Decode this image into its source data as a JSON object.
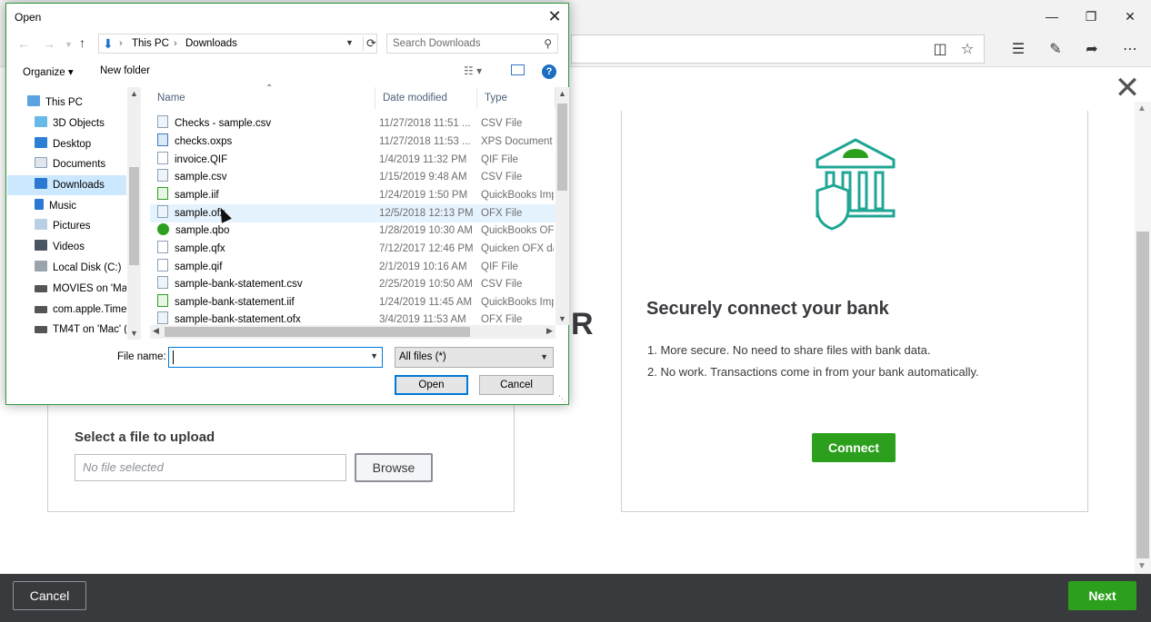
{
  "page": {
    "upload_title": "Select a file to upload",
    "file_field_placeholder": "No file selected",
    "browse_label": "Browse",
    "partial_heading_letter": "R",
    "right_heading": "Securely connect your bank",
    "benefits": [
      "1.  More secure. No need to share files with bank data.",
      "2.  No work. Transactions come in from your bank automatically."
    ],
    "connect_label": "Connect",
    "footer_cancel": "Cancel",
    "footer_next": "Next",
    "close_glyph": "✕"
  },
  "dialog": {
    "title": "Open",
    "breadcrumb": [
      "This PC",
      "Downloads"
    ],
    "search_placeholder": "Search Downloads",
    "organize_label": "Organize ▾",
    "new_folder_label": "New folder",
    "help_label": "?",
    "nav_items": [
      {
        "label": "This PC",
        "icon": "computer-icon"
      },
      {
        "label": "3D Objects",
        "icon": "cube-icon"
      },
      {
        "label": "Desktop",
        "icon": "desktop-icon"
      },
      {
        "label": "Documents",
        "icon": "document-icon"
      },
      {
        "label": "Downloads",
        "icon": "download-icon"
      },
      {
        "label": "Music",
        "icon": "music-icon"
      },
      {
        "label": "Pictures",
        "icon": "picture-icon"
      },
      {
        "label": "Videos",
        "icon": "video-icon"
      },
      {
        "label": "Local Disk (C:)",
        "icon": "disk-icon"
      },
      {
        "label": "MOVIES on 'Mac",
        "icon": "network-drive-icon"
      },
      {
        "label": "com.apple.Time",
        "icon": "network-drive-icon"
      },
      {
        "label": "TM4T on 'Mac' (",
        "icon": "network-drive-icon"
      }
    ],
    "columns": {
      "name": "Name",
      "date": "Date modified",
      "type": "Type"
    },
    "files": [
      {
        "name": "Checks - sample.csv",
        "date": "11/27/2018 11:51 ...",
        "type": "CSV File"
      },
      {
        "name": "checks.oxps",
        "date": "11/27/2018 11:53 ...",
        "type": "XPS Document"
      },
      {
        "name": "invoice.QIF",
        "date": "1/4/2019 11:32 PM",
        "type": "QIF File"
      },
      {
        "name": "sample.csv",
        "date": "1/15/2019 9:48 AM",
        "type": "CSV File"
      },
      {
        "name": "sample.iif",
        "date": "1/24/2019 1:50 PM",
        "type": "QuickBooks Imp"
      },
      {
        "name": "sample.ofx",
        "date": "12/5/2018 12:13 PM",
        "type": "OFX File"
      },
      {
        "name": "sample.qbo",
        "date": "1/28/2019 10:30 AM",
        "type": "QuickBooks OFX"
      },
      {
        "name": "sample.qfx",
        "date": "7/12/2017 12:46 PM",
        "type": "Quicken OFX da"
      },
      {
        "name": "sample.qif",
        "date": "2/1/2019 10:16 AM",
        "type": "QIF File"
      },
      {
        "name": "sample-bank-statement.csv",
        "date": "2/25/2019 10:50 AM",
        "type": "CSV File"
      },
      {
        "name": "sample-bank-statement.iif",
        "date": "1/24/2019 11:45 AM",
        "type": "QuickBooks Imp"
      },
      {
        "name": "sample-bank-statement.ofx",
        "date": "3/4/2019 11:53 AM",
        "type": "OFX File"
      }
    ],
    "file_name_label": "File name:",
    "file_name_value": "",
    "filter_value": "All files (*)",
    "open_label": "Open",
    "cancel_label": "Cancel"
  },
  "colors": {
    "accent_green": "#2ca01c",
    "footer_dark": "#393a3d",
    "selection_blue": "#cce8ff",
    "dialog_border": "#2b9a3f"
  }
}
